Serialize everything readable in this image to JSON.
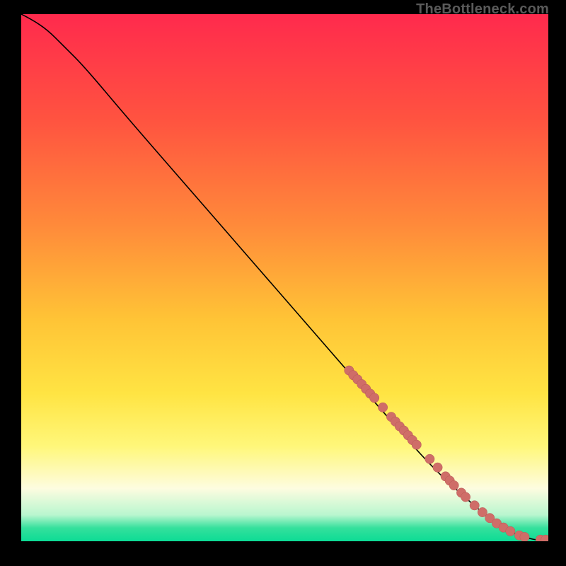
{
  "watermark": "TheBottleneck.com",
  "colors": {
    "background": "#000000",
    "curve": "#000000",
    "marker_fill": "#cf6d68",
    "marker_stroke": "#b85a55"
  },
  "chart_data": {
    "type": "line",
    "title": "",
    "xlabel": "",
    "ylabel": "",
    "xlim": [
      0,
      100
    ],
    "ylim": [
      0,
      100
    ],
    "gradient_stops": [
      {
        "offset": 0.0,
        "color": "#ff2a4d"
      },
      {
        "offset": 0.2,
        "color": "#ff5340"
      },
      {
        "offset": 0.4,
        "color": "#ff8a3a"
      },
      {
        "offset": 0.58,
        "color": "#ffc436"
      },
      {
        "offset": 0.72,
        "color": "#ffe443"
      },
      {
        "offset": 0.82,
        "color": "#fff77a"
      },
      {
        "offset": 0.9,
        "color": "#fdfce0"
      },
      {
        "offset": 0.95,
        "color": "#b9f6cf"
      },
      {
        "offset": 0.975,
        "color": "#34e09c"
      },
      {
        "offset": 1.0,
        "color": "#0cdc95"
      }
    ],
    "series": [
      {
        "name": "curve",
        "x": [
          0,
          2,
          5,
          8,
          12,
          20,
          30,
          40,
          50,
          60,
          70,
          78,
          84,
          88,
          92,
          94,
          96,
          98,
          100
        ],
        "y": [
          100,
          99,
          97,
          94,
          90,
          80.5,
          69,
          57.5,
          46,
          34.5,
          23,
          14,
          8.5,
          5,
          2.3,
          1.3,
          0.6,
          0.2,
          0.2
        ]
      }
    ],
    "markers": [
      {
        "x": 62.2,
        "y": 32.4
      },
      {
        "x": 63.0,
        "y": 31.5
      },
      {
        "x": 63.8,
        "y": 30.7
      },
      {
        "x": 64.6,
        "y": 29.8
      },
      {
        "x": 65.4,
        "y": 28.9
      },
      {
        "x": 66.2,
        "y": 28.0
      },
      {
        "x": 67.0,
        "y": 27.2
      },
      {
        "x": 68.6,
        "y": 25.4
      },
      {
        "x": 70.2,
        "y": 23.6
      },
      {
        "x": 71.0,
        "y": 22.7
      },
      {
        "x": 71.8,
        "y": 21.8
      },
      {
        "x": 72.6,
        "y": 21.0
      },
      {
        "x": 73.4,
        "y": 20.1
      },
      {
        "x": 74.2,
        "y": 19.2
      },
      {
        "x": 75.0,
        "y": 18.3
      },
      {
        "x": 77.5,
        "y": 15.6
      },
      {
        "x": 79.0,
        "y": 14.0
      },
      {
        "x": 80.5,
        "y": 12.3
      },
      {
        "x": 81.3,
        "y": 11.5
      },
      {
        "x": 82.1,
        "y": 10.6
      },
      {
        "x": 83.5,
        "y": 9.2
      },
      {
        "x": 84.3,
        "y": 8.4
      },
      {
        "x": 86.0,
        "y": 6.8
      },
      {
        "x": 87.5,
        "y": 5.5
      },
      {
        "x": 88.9,
        "y": 4.4
      },
      {
        "x": 90.2,
        "y": 3.4
      },
      {
        "x": 91.5,
        "y": 2.6
      },
      {
        "x": 92.8,
        "y": 1.9
      },
      {
        "x": 94.5,
        "y": 1.1
      },
      {
        "x": 95.5,
        "y": 0.8
      },
      {
        "x": 98.5,
        "y": 0.3
      },
      {
        "x": 99.5,
        "y": 0.3
      }
    ],
    "marker_radius_data": 0.9
  }
}
